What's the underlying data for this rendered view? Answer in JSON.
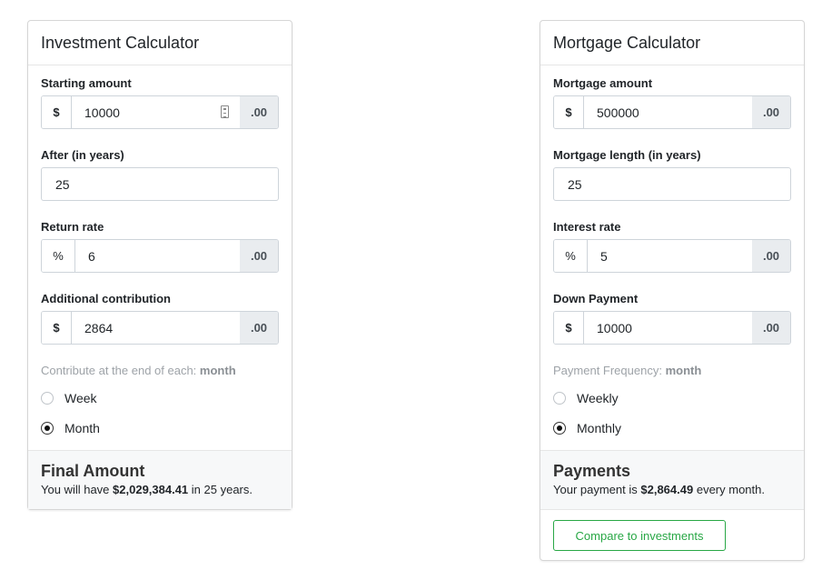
{
  "investment": {
    "title": "Investment Calculator",
    "starting_amount": {
      "label": "Starting amount",
      "prefix": "$",
      "value": "10000",
      "suffix": ".00"
    },
    "after_years": {
      "label": "After (in years)",
      "value": "25"
    },
    "return_rate": {
      "label": "Return rate",
      "prefix": "%",
      "value": "6",
      "suffix": ".00"
    },
    "additional_contribution": {
      "label": "Additional contribution",
      "prefix": "$",
      "value": "2864",
      "suffix": ".00"
    },
    "contribute_hint": "Contribute at the end of each:",
    "contribute_hint_value": "month",
    "options": [
      {
        "label": "Week",
        "checked": false
      },
      {
        "label": "Month",
        "checked": true
      }
    ],
    "result_title": "Final Amount",
    "result_prefix": "You will have",
    "result_amount": "$2,029,384.41",
    "result_suffix": "in 25 years."
  },
  "mortgage": {
    "title": "Mortgage Calculator",
    "mortgage_amount": {
      "label": "Mortgage amount",
      "prefix": "$",
      "value": "500000",
      "suffix": ".00"
    },
    "mortgage_length": {
      "label": "Mortgage length (in years)",
      "value": "25"
    },
    "interest_rate": {
      "label": "Interest rate",
      "prefix": "%",
      "value": "5",
      "suffix": ".00"
    },
    "down_payment": {
      "label": "Down Payment",
      "prefix": "$",
      "value": "10000",
      "suffix": ".00"
    },
    "frequency_hint": "Payment Frequency:",
    "frequency_hint_value": "month",
    "options": [
      {
        "label": "Weekly",
        "checked": false
      },
      {
        "label": "Monthly",
        "checked": true
      }
    ],
    "result_title": "Payments",
    "result_prefix": "Your payment is",
    "result_amount": "$2,864.49",
    "result_suffix": "every month.",
    "compare_button": "Compare to investments"
  },
  "colors": {
    "accent_green": "#28a745",
    "addon_bg": "#e9ecef",
    "border": "#ced4da"
  }
}
